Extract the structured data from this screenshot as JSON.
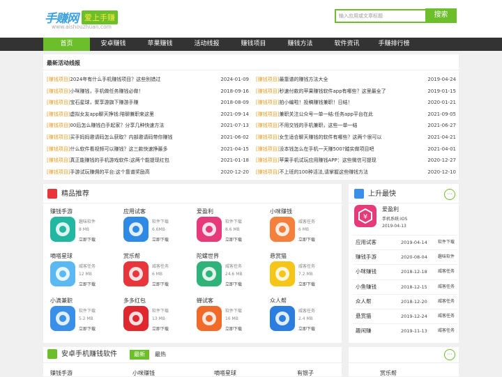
{
  "header": {
    "logo": "手赚网",
    "badge": "爱上手赚",
    "domain": "www.aishouzhuan.com",
    "search_placeholder": "输入应用或文章标题",
    "search_button": "搜索"
  },
  "nav": [
    "首页",
    "安卓赚钱",
    "苹果赚钱",
    "活动线报",
    "赚钱项目",
    "赚钱方法",
    "软件资讯",
    "手赚排行榜"
  ],
  "news": {
    "title": "最新活动线报",
    "left": [
      {
        "tag": "[赚钱项目]",
        "title": "2024年有什么手机赚钱项目？这些别错过",
        "date": "2024-01-09"
      },
      {
        "tag": "[赚钱项目]",
        "title": "小咪赚钱，手机做任务赚钱必做！",
        "date": "2018-09-16"
      },
      {
        "tag": "[赚钱项目]",
        "title": "宝石星球，聚享游旗下赚游手赚",
        "date": "2018-08-09"
      },
      {
        "tag": "[赚钱项目]",
        "title": "虚拟女友app聊天挣钱:陪聊兼职来这里",
        "date": "2021-09-14"
      },
      {
        "tag": "[赚钱项目]",
        "title": "00后怎么赚钱白手起家？分享几种快速方法",
        "date": "2021-07-13"
      },
      {
        "tag": "[赚钱项目]",
        "title": "买手妈妈邀请码怎么获取？内部邀请码带你赚钱",
        "date": "2021-06-02"
      },
      {
        "tag": "[赚钱项目]",
        "title": "什么软件看视频可以赚钱？这三款快速挣最多",
        "date": "2021-04-15"
      },
      {
        "tag": "[赚钱项目]",
        "title": "真正能赚钱的手机游戏软件:这两个能提现红包",
        "date": "2021-01-18"
      },
      {
        "tag": "[赚钱项目]",
        "title": "手游试玩赚佣的平台:这个靠谱奖励高",
        "date": "2020-12-20"
      }
    ],
    "right": [
      {
        "tag": "[赚钱项目]",
        "title": "最靠谱的赚钱方法大全",
        "date": "2019-04-24"
      },
      {
        "tag": "[赚钱项目]",
        "title": "秒速付款的苹果赚钱软件app有哪些？这里最全了",
        "date": "2019-01-15"
      },
      {
        "tag": "[赚钱项目]",
        "title": "拍小编啦！投稿赚钱兼职！日结！",
        "date": "2020-01-21"
      },
      {
        "tag": "[赚钱项目]",
        "title": "兼职关注公众号一单一结:任务app平台在此",
        "date": "2021-09-05"
      },
      {
        "tag": "[赚钱项目]",
        "title": "不用交钱的手机兼职，这些一单一结",
        "date": "2021-06-27"
      },
      {
        "tag": "[赚钱项目]",
        "title": "女生适合聊天赚钱的软件有哪些？这两个很可以",
        "date": "2021-04-21"
      },
      {
        "tag": "[赚钱项目]",
        "title": "没本钱怎么在手机一天赚500?踏实做项目吧",
        "date": "2021-04-01"
      },
      {
        "tag": "[赚钱项目]",
        "title": "苹果手机试玩应用赚钱APP：这些微信可提现",
        "date": "2020-12-27"
      },
      {
        "tag": "[赚钱项目]",
        "title": "不上班的100种活法,请掌握这些赚钱方法",
        "date": "2020-12-10"
      }
    ]
  },
  "featured": {
    "title": "精品推荐",
    "apps": [
      {
        "name": "赚钱手游",
        "cat": "趣味软件",
        "size": "8 MB",
        "dl": "立即下载",
        "color": "#23b7a2",
        "icon": "game-controller-icon"
      },
      {
        "name": "应用试客",
        "cat": "软件下载",
        "size": "6.6MB",
        "dl": "立即下载",
        "color": "#2f8ae6",
        "icon": "trial-icon"
      },
      {
        "name": "爱盈利",
        "cat": "软件下载",
        "size": "8.6 MB",
        "dl": "立即下载",
        "color": "#e63b7a",
        "icon": "yen-icon"
      },
      {
        "name": "小咪赚钱",
        "cat": "威客任务",
        "size": "6 MB",
        "dl": "立即下载",
        "color": "#f5803e",
        "icon": "runner-icon"
      },
      {
        "name": "嘀嗒星球",
        "cat": "威客任务",
        "size": "12 MB",
        "dl": "立即下载",
        "color": "#5cb8f2",
        "icon": "planet-icon"
      },
      {
        "name": "赏乐帮",
        "cat": "威客任务",
        "size": "6 MB",
        "dl": "立即下载",
        "color": "#e8343b",
        "icon": "reward-icon"
      },
      {
        "name": "陀螺世界",
        "cat": "威客任务",
        "size": "24.6 MB",
        "dl": "立即下载",
        "color": "#2fb37a",
        "icon": "dinosaur-icon"
      },
      {
        "name": "悬赏猫",
        "cat": "威客任务",
        "size": "7.2 MB",
        "dl": "立即下载",
        "color": "#f5c518",
        "icon": "cat-icon"
      },
      {
        "name": "小滴兼职",
        "cat": "软件下载",
        "size": "5.2 MB",
        "dl": "立即下载",
        "color": "#3a8fe8",
        "icon": "pig-icon"
      },
      {
        "name": "多多红包",
        "cat": "软件下载",
        "size": "13 MB",
        "dl": "立即下载",
        "color": "#e0262f",
        "icon": "red-envelope-icon"
      },
      {
        "name": "蝉试客",
        "cat": "软件下载",
        "size": "16 MB",
        "dl": "立即下载",
        "color": "#f06a2a",
        "icon": "cicada-icon"
      },
      {
        "name": "众人帮",
        "cat": "威客任务",
        "size": "2.4 MB",
        "dl": "立即下载",
        "color": "#2b7de0",
        "icon": "help-icon"
      }
    ]
  },
  "rising": {
    "title": "上升最快",
    "top": {
      "name": "爱盈利",
      "sys": "手机系统:IOS",
      "date": "2019-04-13"
    },
    "rows": [
      {
        "name": "应用试客",
        "date": "2019-04-14",
        "cat": "软件下载"
      },
      {
        "name": "赚钱手游",
        "date": "2020-08-04",
        "cat": "趣味软件"
      },
      {
        "name": "小咪赚钱",
        "date": "2018-12-18",
        "cat": "威客任务"
      },
      {
        "name": "小鱼赚钱",
        "date": "2018-12-15",
        "cat": "威客任务"
      },
      {
        "name": "众人帮",
        "date": "2018-12-20",
        "cat": "威客任务"
      },
      {
        "name": "悬赏猫",
        "date": "2019-12-24",
        "cat": "威客任务"
      },
      {
        "name": "趣闲赚",
        "date": "2019-11-13",
        "cat": "威客任务"
      }
    ]
  },
  "android": {
    "title": "安卓手机赚钱软件",
    "tab_new": "最新",
    "tab_hot": "最热",
    "apps": [
      "赚钱手游",
      "小咪赚钱",
      "嘀嗒星球",
      "有银子",
      "赏乐帮"
    ]
  },
  "more": "···",
  "colors": {
    "green": "#6cbf2a",
    "tag": "#e89a1c"
  }
}
